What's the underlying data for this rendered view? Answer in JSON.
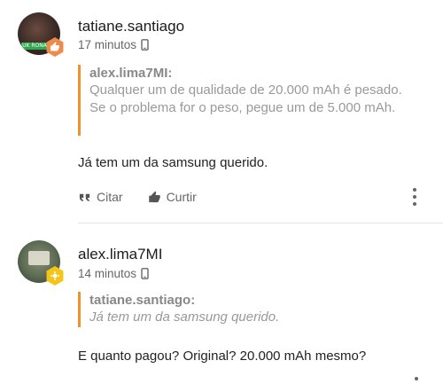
{
  "comments": [
    {
      "username": "tatiane.santiago",
      "time": "17 minutos",
      "quote": {
        "author": "alex.lima7MI:",
        "text": "Qualquer um de qualidade de 20.000 mAh é pesado. Se o problema for o peso, pegue um de 5.000 mAh."
      },
      "body": "Já tem um da samsung querido.",
      "actions": {
        "quote_label": "Citar",
        "like_label": "Curtir"
      },
      "avatar_tag": "UK RONA"
    },
    {
      "username": "alex.lima7MI",
      "time": "14 minutos",
      "quote": {
        "author": "tatiane.santiago:",
        "text": "Já tem um da samsung querido."
      },
      "body": "E quanto pagou? Original? 20.000 mAh mesmo?"
    }
  ],
  "colors": {
    "quote_border": "#f0922a",
    "badge_orange": "#f08a4b",
    "badge_yellow": "#f4c518"
  },
  "icons": [
    "phone-icon",
    "quote-icon",
    "thumbs-up-icon",
    "more-vertical-icon",
    "badge-icon"
  ]
}
